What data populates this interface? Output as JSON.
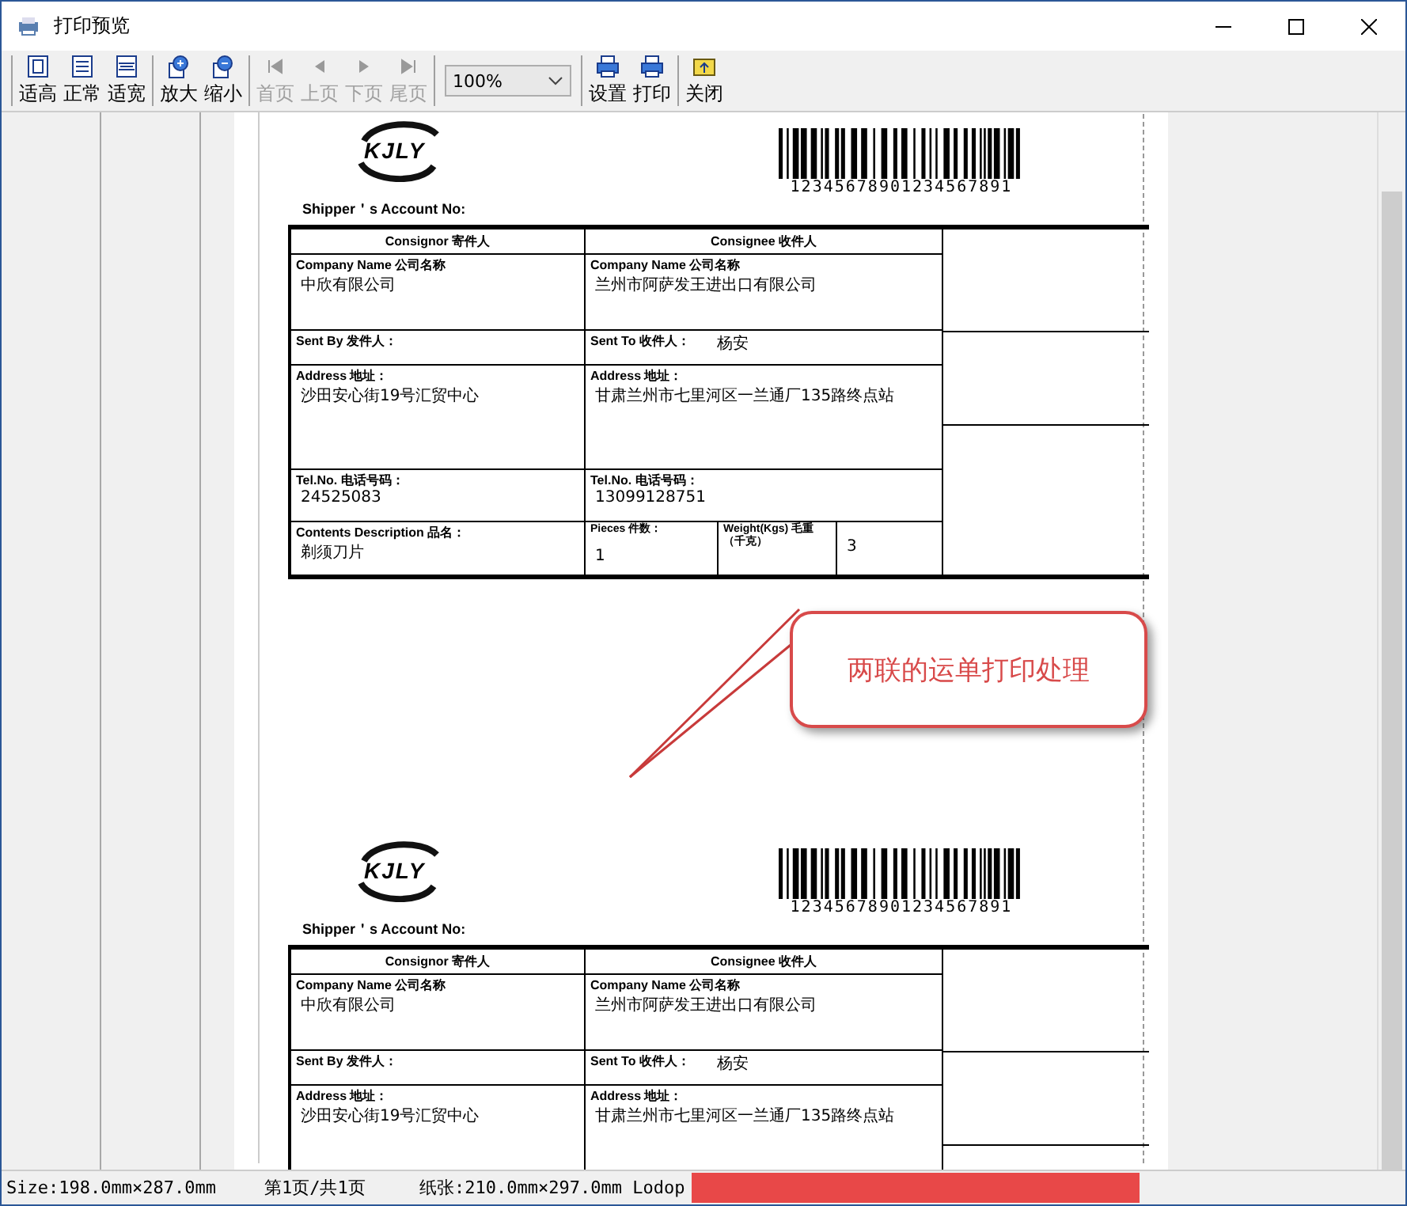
{
  "window": {
    "title": "打印预览"
  },
  "toolbar": {
    "groups": [
      [
        {
          "kind": "fit-height",
          "label": "适高",
          "disabled": false
        },
        {
          "kind": "normal",
          "label": "正常",
          "disabled": false
        },
        {
          "kind": "fit-width",
          "label": "适宽",
          "disabled": false
        }
      ],
      [
        {
          "kind": "zoom-in",
          "label": "放大",
          "disabled": false
        },
        {
          "kind": "zoom-out",
          "label": "缩小",
          "disabled": false
        }
      ],
      [
        {
          "kind": "first",
          "label": "首页",
          "disabled": true
        },
        {
          "kind": "prev",
          "label": "上页",
          "disabled": true
        },
        {
          "kind": "next",
          "label": "下页",
          "disabled": true
        },
        {
          "kind": "last",
          "label": "尾页",
          "disabled": true
        }
      ],
      [
        {
          "kind": "zoom-select",
          "value": "100%"
        }
      ],
      [
        {
          "kind": "setup",
          "label": "设置",
          "disabled": false
        },
        {
          "kind": "print",
          "label": "打印",
          "disabled": false
        }
      ],
      [
        {
          "kind": "close",
          "label": "关闭",
          "disabled": false
        }
      ]
    ]
  },
  "waybills": [
    {
      "logo": "KJLY",
      "barcode_number": "12345678901234567891",
      "account_label": "Shipper＇s Account No:",
      "consignor_header": "Consignor 寄件人",
      "consignee_header": "Consignee 收件人",
      "rows": [
        {
          "kind": "company",
          "left_label": "Company Name 公司名称",
          "left_value": "中欣有限公司",
          "right_label": "Company Name 公司名称",
          "right_value": "兰州市阿萨发王进出口有限公司"
        },
        {
          "kind": "sent",
          "left_label": "Sent By 发件人：",
          "right_label": "Sent To 收件人：",
          "right_value": "杨安"
        },
        {
          "kind": "address",
          "left_label": "Address 地址：",
          "left_value": "沙田安心街19号汇贸中心",
          "right_label": "Address 地址：",
          "right_value": "甘肃兰州市七里河区一兰通厂135路终点站"
        },
        {
          "kind": "tel",
          "left_label": "Tel.No. 电话号码：",
          "left_value": "24525083",
          "right_label": "Tel.No. 电话号码：",
          "right_value": "13099128751"
        },
        {
          "kind": "contents",
          "left_label": "Contents Description 品名：",
          "left_value": "剃须刀片",
          "pieces_label": "Pieces 件数：",
          "pieces_value": "1",
          "weight_label": "Weight(Kgs) 毛重（千克）",
          "weight_value": "3"
        }
      ]
    },
    {
      "logo": "KJLY",
      "barcode_number": "12345678901234567891",
      "account_label": "Shipper＇s Account No:",
      "consignor_header": "Consignor 寄件人",
      "consignee_header": "Consignee 收件人",
      "rows": [
        {
          "kind": "company",
          "left_label": "Company Name 公司名称",
          "left_value": "中欣有限公司",
          "right_label": "Company Name 公司名称",
          "right_value": "兰州市阿萨发王进出口有限公司"
        },
        {
          "kind": "sent",
          "left_label": "Sent By 发件人：",
          "right_label": "Sent To 收件人：",
          "right_value": "杨安"
        },
        {
          "kind": "address",
          "left_label": "Address 地址：",
          "left_value": "沙田安心街19号汇贸中心",
          "right_label": "Address 地址：",
          "right_value": "甘肃兰州市七里河区一兰通厂135路终点站"
        }
      ]
    }
  ],
  "callout": {
    "text": "两联的运单打印处理"
  },
  "status_bar": {
    "size": "Size:198.0mm×287.0mm",
    "page": "第1页/共1页",
    "paper": "纸张:210.0mm×297.0mm Lodop"
  }
}
